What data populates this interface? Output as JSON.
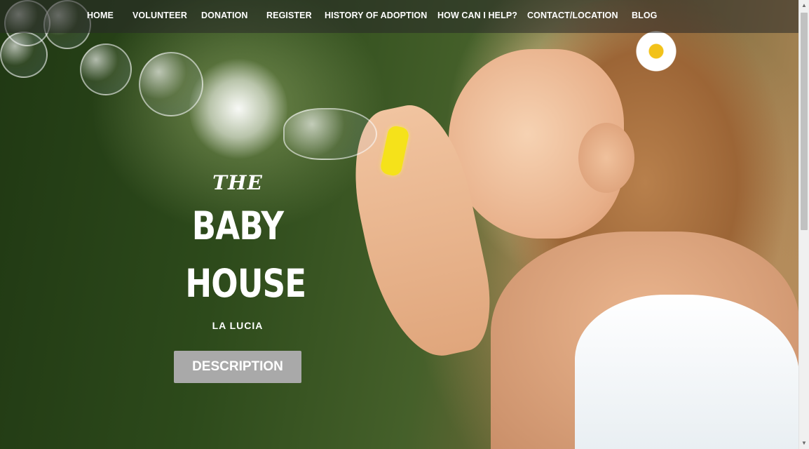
{
  "nav": {
    "items": [
      {
        "label": "HOME"
      },
      {
        "label": "VOLUNTEER"
      },
      {
        "label": "DONATION"
      },
      {
        "label": "REGISTER"
      },
      {
        "label": "HISTORY OF ADOPTION"
      },
      {
        "label": "HOW CAN I HELP?"
      },
      {
        "label": "CONTACT/LOCATION"
      },
      {
        "label": "BLOG"
      }
    ]
  },
  "hero": {
    "the": "THE",
    "line1": "BABY",
    "line2": "HOUSE",
    "subtitle": "LA LUCIA",
    "button_label": "DESCRIPTION",
    "image_icon": "girl-blowing-bubbles-photo"
  },
  "scrollbar": {
    "up_icon": "▲",
    "down_icon": "▼"
  },
  "colors": {
    "nav_bg": "#282828",
    "button_bg": "#a9a9a9",
    "text": "#ffffff"
  }
}
